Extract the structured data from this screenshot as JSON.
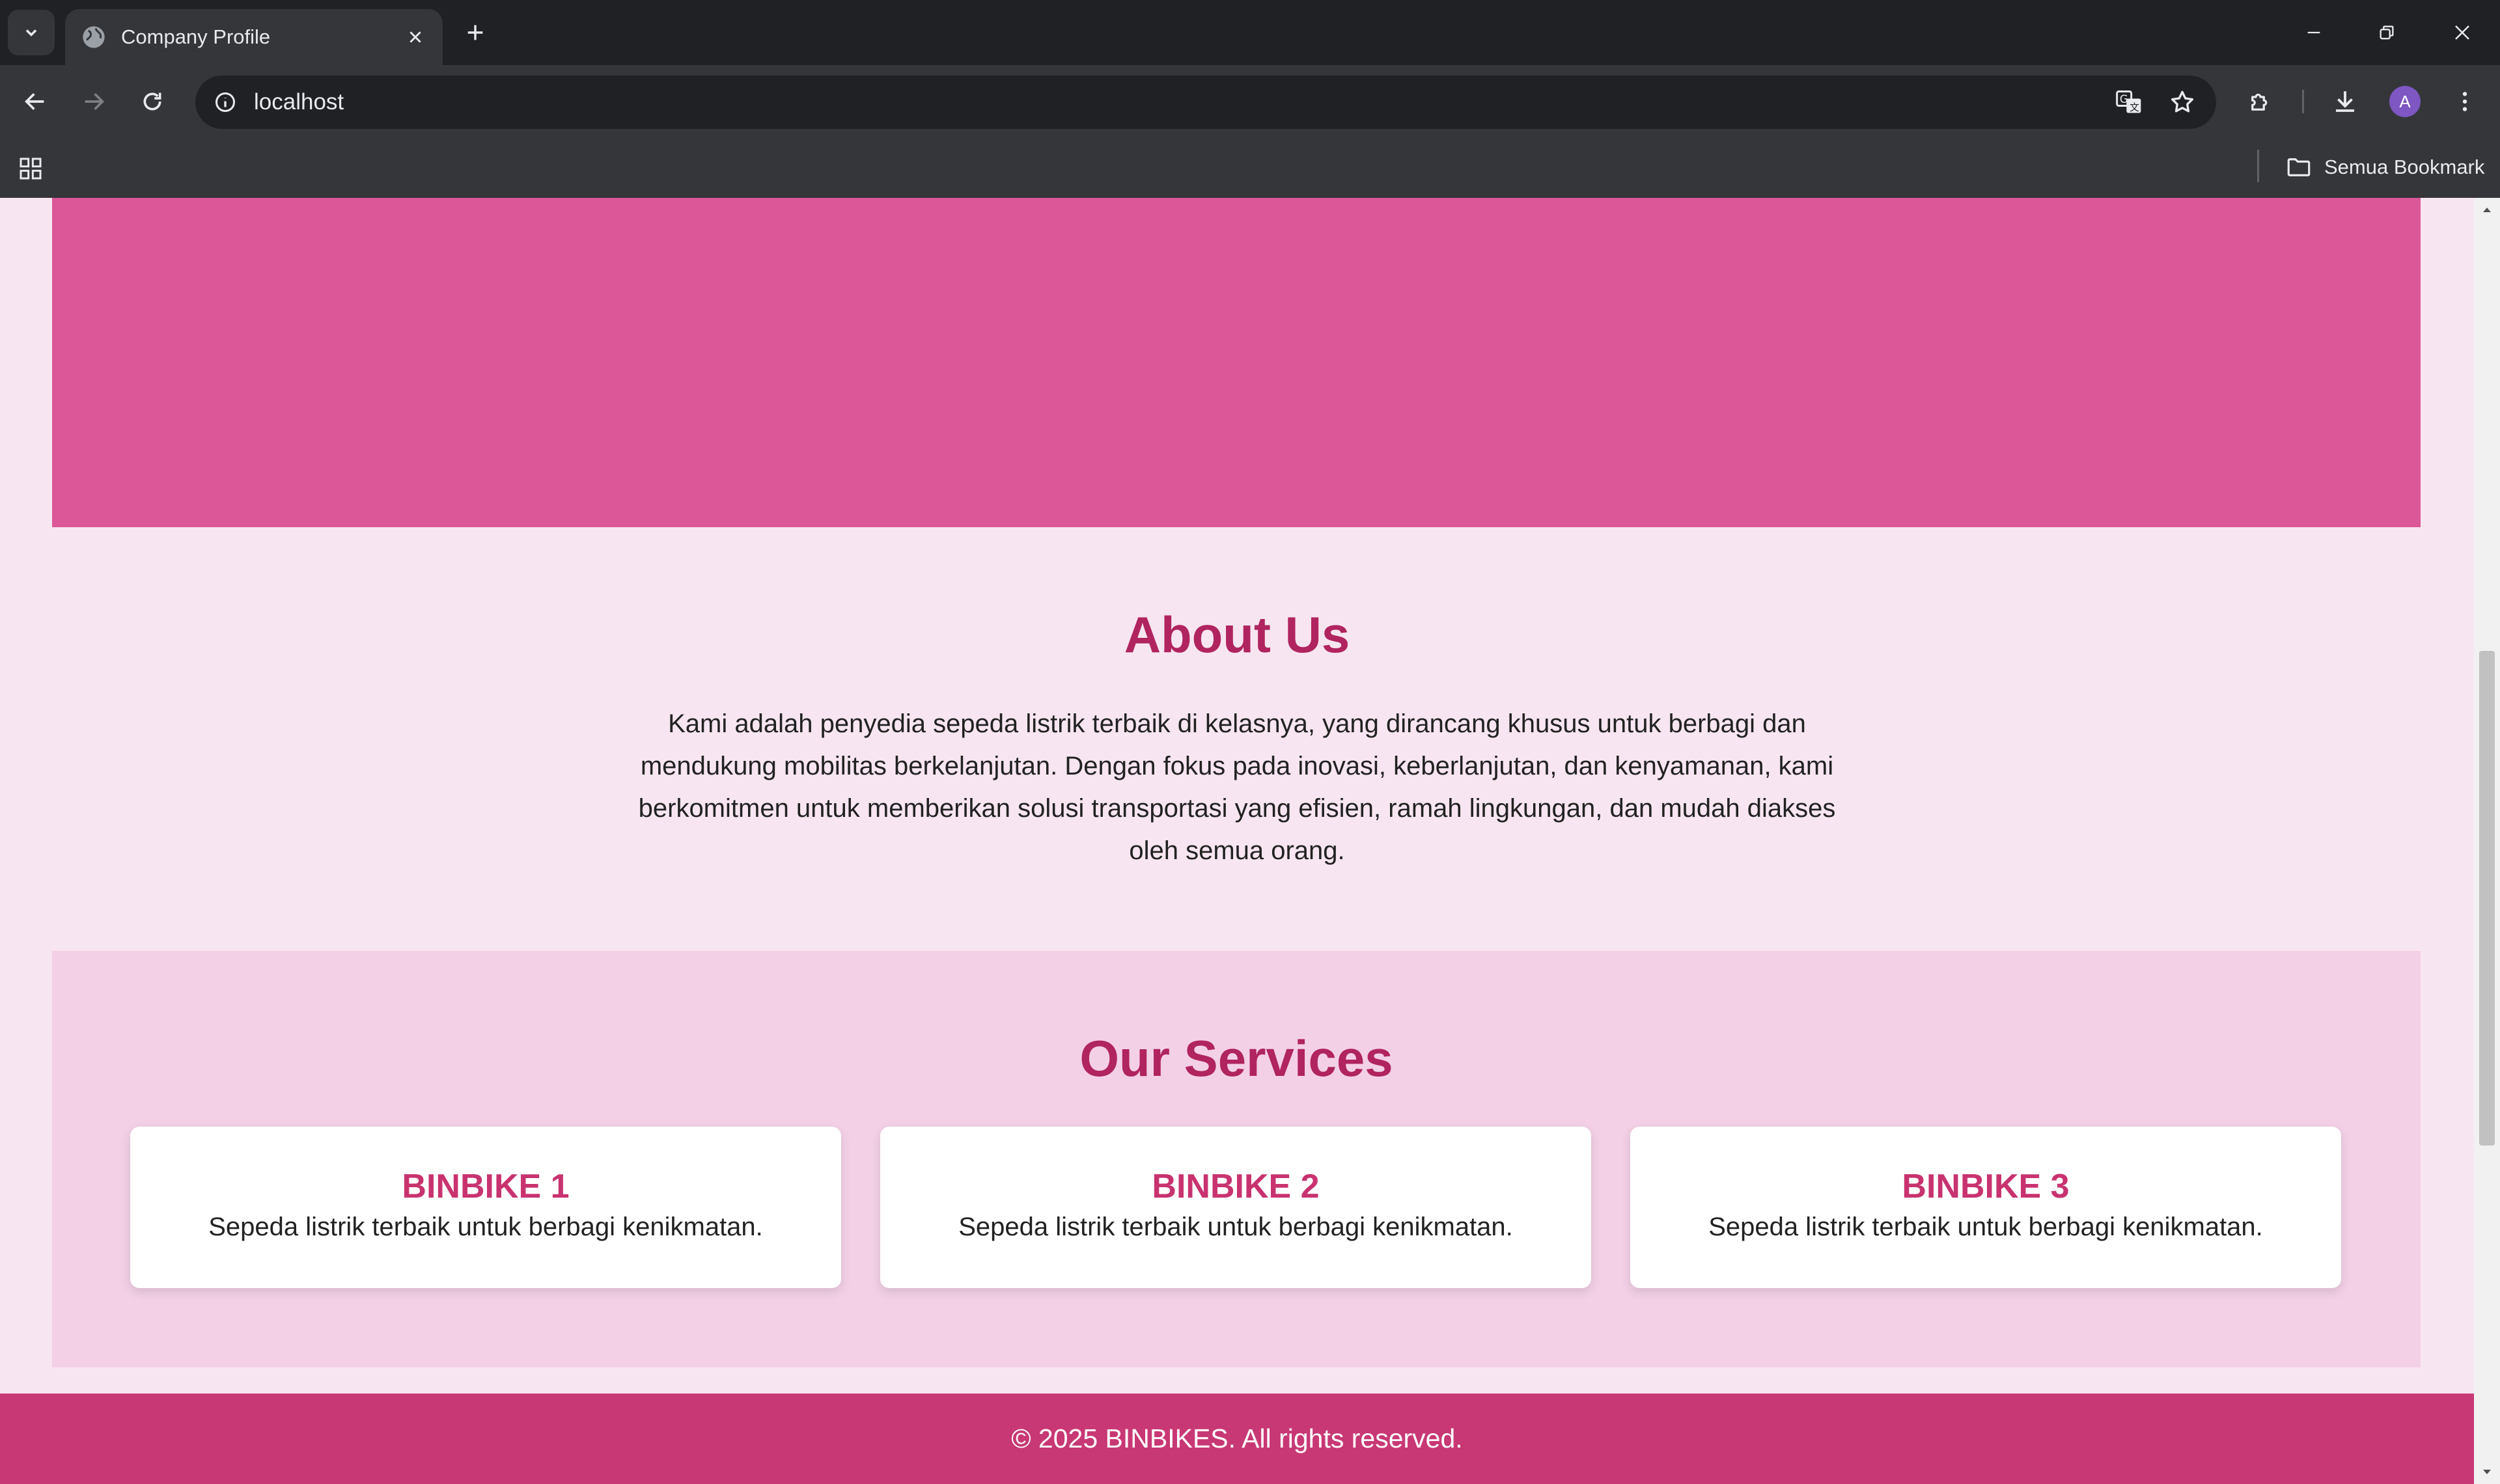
{
  "browser": {
    "tab_title": "Company Profile",
    "url": "localhost",
    "profile_initial": "A",
    "bookmarks_all_label": "Semua Bookmark"
  },
  "page": {
    "about": {
      "title": "About Us",
      "text": "Kami adalah penyedia sepeda listrik terbaik di kelasnya, yang dirancang khusus untuk berbagi dan mendukung mobilitas berkelanjutan. Dengan fokus pada inovasi, keberlanjutan, dan kenyamanan, kami berkomitmen untuk memberikan solusi transportasi yang efisien, ramah lingkungan, dan mudah diakses oleh semua orang."
    },
    "services": {
      "title": "Our Services",
      "cards": [
        {
          "title": "BINBIKE 1",
          "text": "Sepeda listrik terbaik untuk berbagi kenikmatan."
        },
        {
          "title": "BINBIKE 2",
          "text": "Sepeda listrik terbaik untuk berbagi kenikmatan."
        },
        {
          "title": "BINBIKE 3",
          "text": "Sepeda listrik terbaik untuk berbagi kenikmatan."
        }
      ]
    },
    "footer": {
      "text": "© 2025 BINBIKES. All rights reserved."
    }
  },
  "colors": {
    "hero": "#db5797",
    "heading": "#b0245f",
    "card_title": "#c8336f",
    "page_bg": "#f7e6f1",
    "services_bg": "#f3d0e6",
    "footer_bg": "#c83875"
  },
  "scroll_position_fraction": 0.36
}
